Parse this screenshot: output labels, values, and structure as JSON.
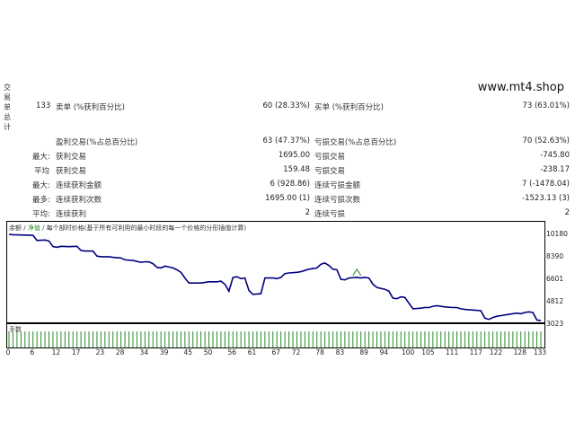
{
  "side_title": "交易单总计",
  "watermark": "www.mt4.shop",
  "stats": {
    "total_trades": "133",
    "short_label": "卖单 (%获利百分比)",
    "short_value": "60 (28.33%)",
    "long_label": "买单 (%获利百分比)",
    "long_value": "73 (63.01%)",
    "profit_trades_label": "盈利交易(%占总百分比)",
    "profit_trades_value": "63 (47.37%)",
    "loss_trades_label": "亏损交易(%占总百分比)",
    "loss_trades_value": "70 (52.63%)",
    "largest_prefix": "最大:",
    "largest_profit_label": "获利交易",
    "largest_profit_value": "1695.00",
    "largest_loss_label": "亏损交易",
    "largest_loss_value": "-745.80",
    "average_prefix": "平均",
    "avg_profit_label": "获利交易",
    "avg_profit_value": "159.48",
    "avg_loss_label": "亏损交易",
    "avg_loss_value": "-238.17",
    "max_prefix": "最大:",
    "max_consec_wins_label": "连续获利金额",
    "max_consec_wins_value": "6 (928.86)",
    "max_consec_losses_label": "连续亏损金额",
    "max_consec_losses_value": "7 (-1478.04)",
    "maximal_prefix": "最多:",
    "max_consec_profit_label": "连续获利次数",
    "max_consec_profit_value": "1695.00 (1)",
    "max_consec_loss_label": "连续亏损次数",
    "max_consec_loss_value": "-1523.13 (3)",
    "avg2_prefix": "平均:",
    "avg_consec_wins_label": "连续获利",
    "avg_consec_wins_value": "2",
    "avg_consec_losses_label": "连续亏损",
    "avg_consec_losses_value": "2"
  },
  "chart": {
    "legend_balance": "余额",
    "legend_slash": "/",
    "legend_equity": "净值",
    "legend_rest": "/ 每个部时价格(基于所有可利用的最小时段的每一个价格的分形插值计算)",
    "volume_label": "手数",
    "line_color": "#00007f",
    "equity_marker_color": "#2e8b2e",
    "volume_color": "#2e8b2e"
  },
  "chart_data": {
    "type": "line",
    "title": "",
    "y_ticks": [
      10180,
      8390,
      6601,
      4812,
      3023
    ],
    "x_ticks": [
      0,
      6,
      12,
      17,
      23,
      28,
      34,
      39,
      45,
      50,
      56,
      61,
      67,
      72,
      78,
      83,
      89,
      94,
      100,
      105,
      111,
      117,
      122,
      128,
      133
    ],
    "ylim": [
      3023,
      10180
    ],
    "xlim": [
      0,
      133
    ],
    "balance": [
      [
        0,
        10180
      ],
      [
        1,
        10150
      ],
      [
        6,
        10100
      ],
      [
        7,
        9690
      ],
      [
        9,
        9730
      ],
      [
        10,
        9650
      ],
      [
        11,
        9200
      ],
      [
        12,
        9150
      ],
      [
        13,
        9230
      ],
      [
        15,
        9200
      ],
      [
        17,
        9230
      ],
      [
        18,
        8900
      ],
      [
        19,
        8850
      ],
      [
        21,
        8850
      ],
      [
        22,
        8450
      ],
      [
        23,
        8400
      ],
      [
        25,
        8400
      ],
      [
        26,
        8350
      ],
      [
        28,
        8300
      ],
      [
        29,
        8150
      ],
      [
        31,
        8100
      ],
      [
        33,
        7950
      ],
      [
        34,
        8000
      ],
      [
        35,
        7980
      ],
      [
        36,
        7850
      ],
      [
        37,
        7550
      ],
      [
        38,
        7500
      ],
      [
        39,
        7650
      ],
      [
        41,
        7500
      ],
      [
        42,
        7350
      ],
      [
        43,
        7150
      ],
      [
        44,
        6700
      ],
      [
        45,
        6300
      ],
      [
        48,
        6300
      ],
      [
        50,
        6400
      ],
      [
        52,
        6400
      ],
      [
        53,
        6450
      ],
      [
        54,
        6200
      ],
      [
        55,
        5650
      ],
      [
        56,
        6750
      ],
      [
        57,
        6800
      ],
      [
        58,
        6650
      ],
      [
        59,
        6700
      ],
      [
        60,
        5700
      ],
      [
        61,
        5400
      ],
      [
        63,
        5450
      ],
      [
        64,
        6700
      ],
      [
        66,
        6700
      ],
      [
        67,
        6650
      ],
      [
        68,
        6750
      ],
      [
        69,
        7050
      ],
      [
        70,
        7100
      ],
      [
        72,
        7150
      ],
      [
        73,
        7200
      ],
      [
        74,
        7300
      ],
      [
        75,
        7400
      ],
      [
        77,
        7500
      ],
      [
        78,
        7800
      ],
      [
        79,
        7900
      ],
      [
        80,
        7700
      ],
      [
        81,
        7400
      ],
      [
        82,
        7350
      ],
      [
        83,
        6600
      ],
      [
        84,
        6550
      ],
      [
        85,
        6700
      ],
      [
        87,
        6750
      ],
      [
        88,
        6700
      ],
      [
        89,
        6750
      ],
      [
        90,
        6700
      ],
      [
        91,
        6200
      ],
      [
        92,
        5950
      ],
      [
        94,
        5800
      ],
      [
        95,
        5650
      ],
      [
        96,
        5100
      ],
      [
        97,
        5050
      ],
      [
        98,
        5200
      ],
      [
        99,
        5150
      ],
      [
        100,
        4700
      ],
      [
        101,
        4250
      ],
      [
        103,
        4300
      ],
      [
        104,
        4350
      ],
      [
        105,
        4350
      ],
      [
        106,
        4450
      ],
      [
        107,
        4500
      ],
      [
        109,
        4400
      ],
      [
        111,
        4350
      ],
      [
        112,
        4350
      ],
      [
        113,
        4250
      ],
      [
        114,
        4200
      ],
      [
        116,
        4150
      ],
      [
        118,
        4100
      ],
      [
        119,
        3500
      ],
      [
        120,
        3400
      ],
      [
        121,
        3550
      ],
      [
        122,
        3650
      ],
      [
        123,
        3700
      ],
      [
        125,
        3800
      ],
      [
        127,
        3900
      ],
      [
        128,
        3850
      ],
      [
        129,
        3950
      ],
      [
        130,
        4000
      ],
      [
        131,
        3950
      ],
      [
        132,
        3350
      ],
      [
        133,
        3300
      ]
    ],
    "equity_spike": [
      [
        86,
        6900
      ],
      [
        87,
        7400
      ],
      [
        88,
        6900
      ]
    ]
  }
}
